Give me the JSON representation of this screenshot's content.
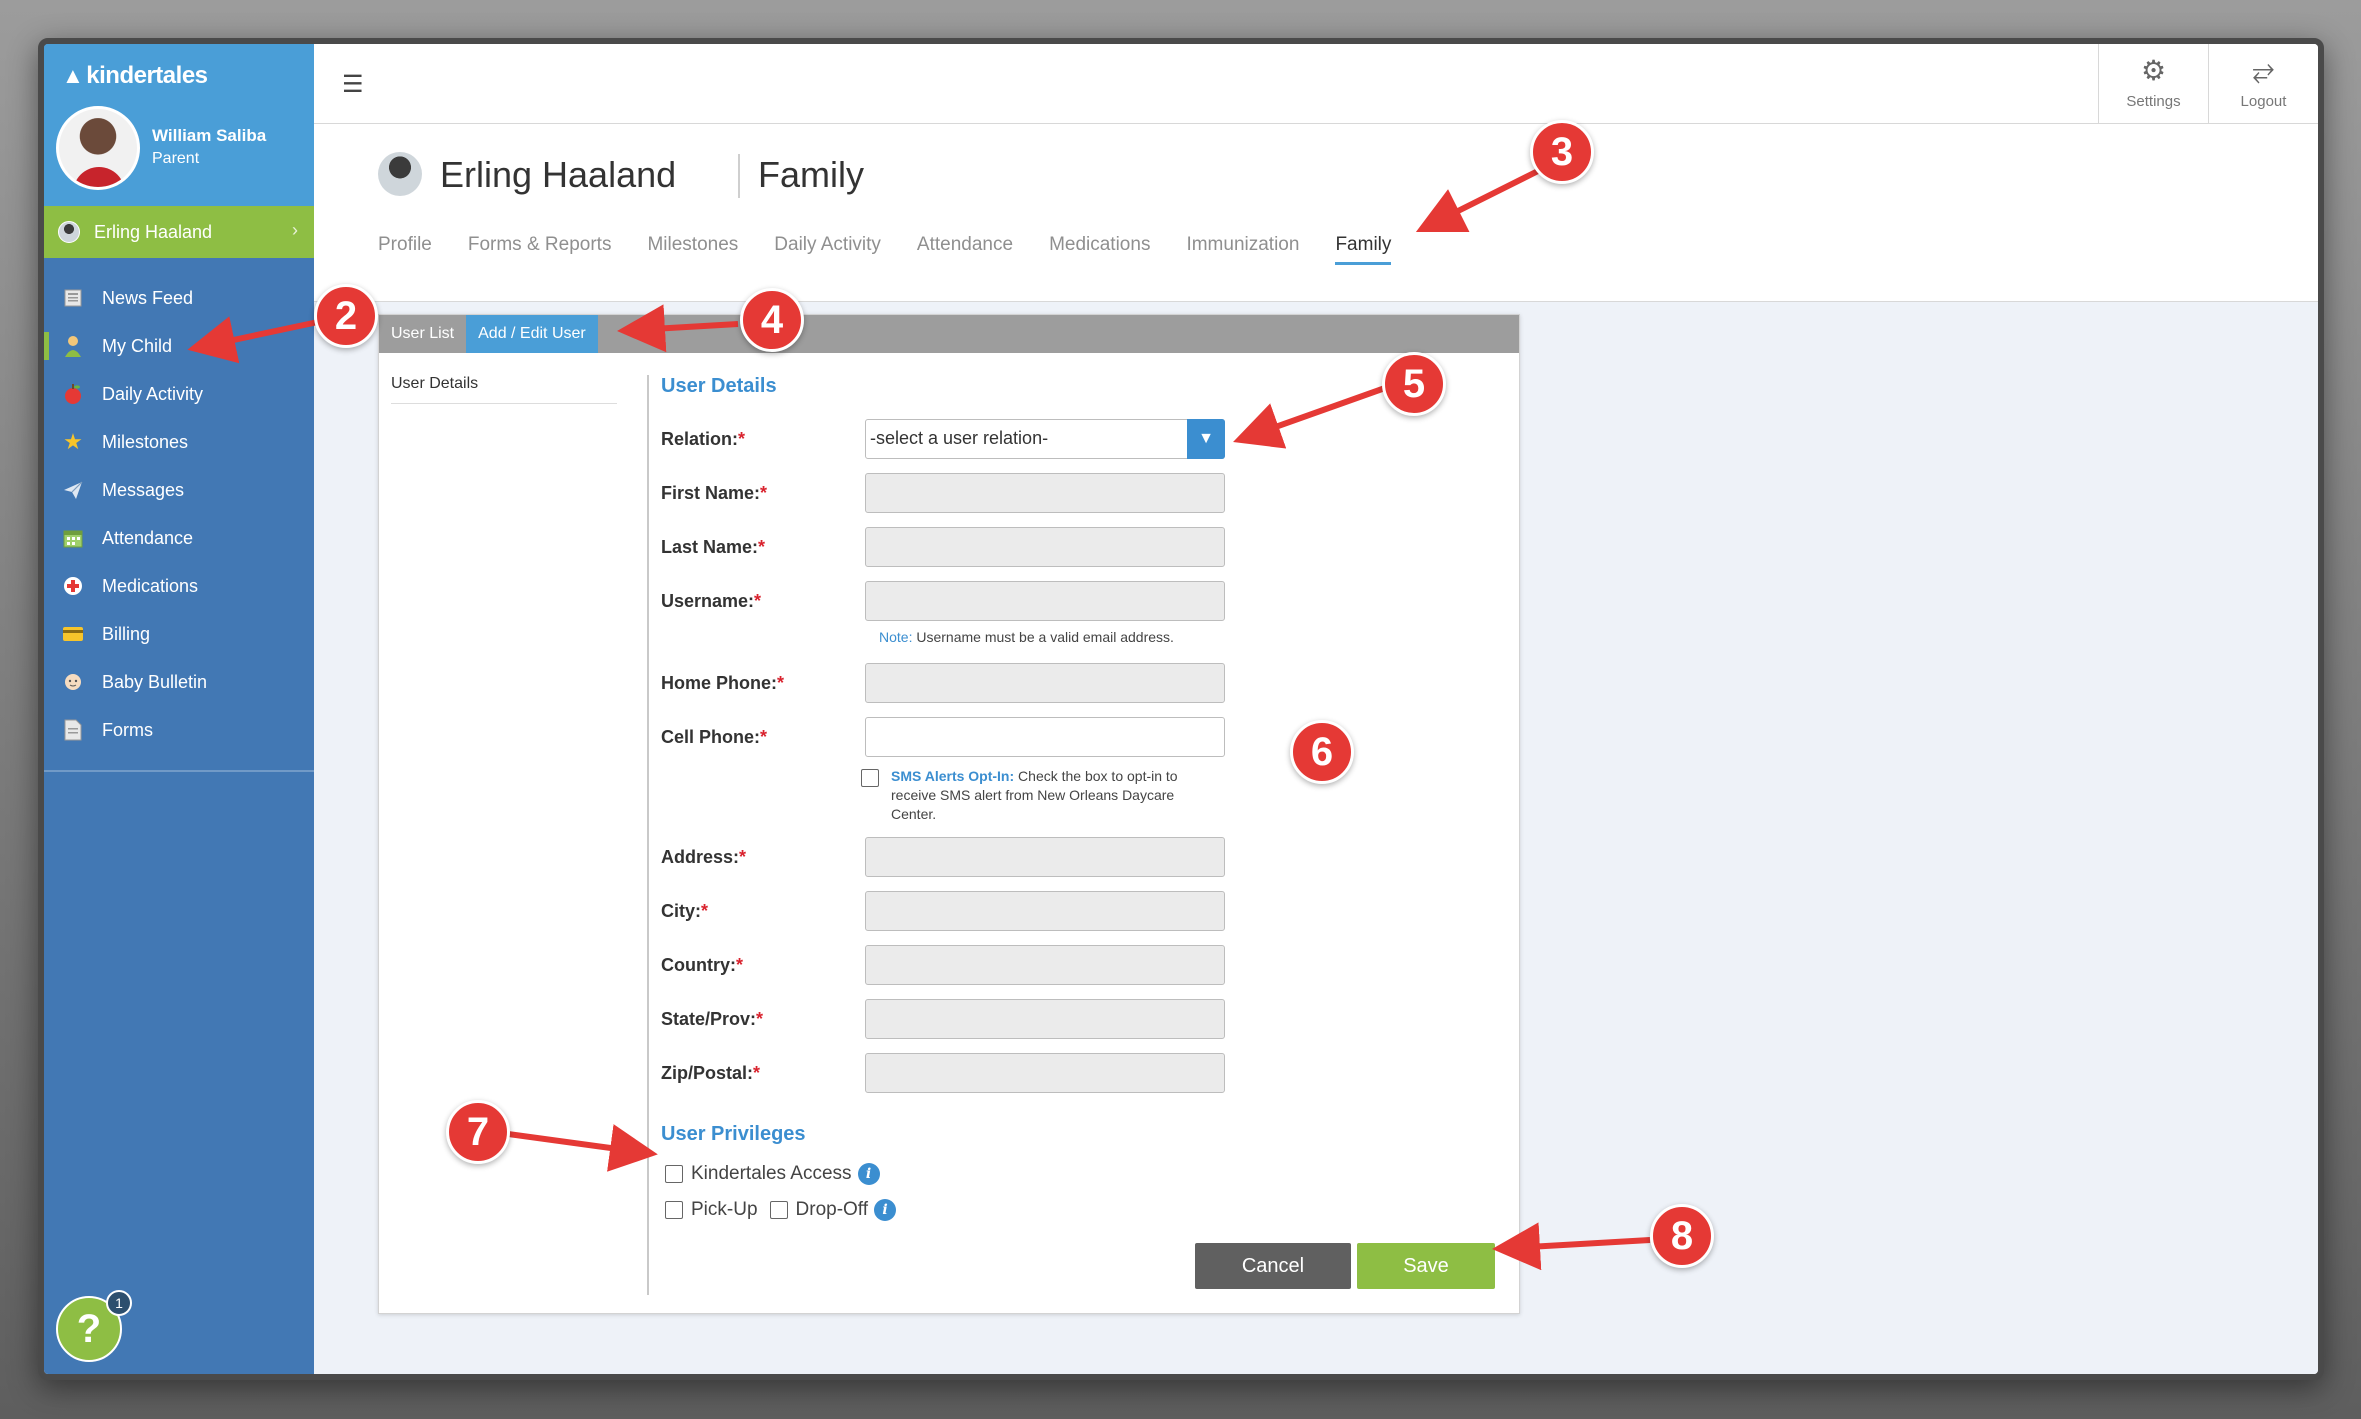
{
  "sidebar": {
    "brand": "kindertales",
    "user_name": "William Saliba",
    "user_role": "Parent",
    "child_name": "Erling Haaland",
    "items": [
      {
        "label": "News Feed",
        "icon": "newspaper-icon"
      },
      {
        "label": "My Child",
        "icon": "child-icon"
      },
      {
        "label": "Daily Activity",
        "icon": "apple-icon"
      },
      {
        "label": "Milestones",
        "icon": "star-icon"
      },
      {
        "label": "Messages",
        "icon": "paper-plane-icon"
      },
      {
        "label": "Attendance",
        "icon": "calendar-icon"
      },
      {
        "label": "Medications",
        "icon": "medical-cross-icon"
      },
      {
        "label": "Billing",
        "icon": "credit-card-icon"
      },
      {
        "label": "Baby Bulletin",
        "icon": "baby-icon"
      },
      {
        "label": "Forms",
        "icon": "document-icon"
      }
    ],
    "help_badge": "1",
    "help_label": "?"
  },
  "topbar": {
    "settings_label": "Settings",
    "logout_label": "Logout"
  },
  "header": {
    "child_name": "Erling Haaland",
    "section": "Family",
    "tabs": [
      "Profile",
      "Forms & Reports",
      "Milestones",
      "Daily Activity",
      "Attendance",
      "Medications",
      "Immunization",
      "Family"
    ]
  },
  "card": {
    "tabs": [
      "User List",
      "Add / Edit User"
    ],
    "left_item": "User Details",
    "section_title": "User Details",
    "fields": {
      "relation": "Relation:",
      "relation_placeholder": "-select a user relation-",
      "first_name": "First Name:",
      "last_name": "Last Name:",
      "username": "Username:",
      "username_note_prefix": "Note:",
      "username_note": " Username must be a valid email address.",
      "home_phone": "Home Phone:",
      "cell_phone": "Cell Phone:",
      "sms_title": "SMS Alerts Opt-In:",
      "sms_text": " Check the box to opt-in to receive SMS alert from New Orleans Daycare Center.",
      "address": "Address:",
      "city": "City:",
      "country": "Country:",
      "state": "State/Prov:",
      "zip": "Zip/Postal:"
    },
    "privileges_title": "User Privileges",
    "privileges": {
      "access": "Kindertales Access",
      "pickup": "Pick-Up",
      "dropoff": "Drop-Off"
    },
    "cancel_label": "Cancel",
    "save_label": "Save"
  },
  "annotations": [
    "2",
    "3",
    "4",
    "5",
    "6",
    "7",
    "8"
  ],
  "colors": {
    "sidebar": "#4278b4",
    "sidebar_top": "#4a9ed7",
    "accent_green": "#8ebe44",
    "accent_blue": "#3b8ed0",
    "callout_red": "#e53935"
  }
}
